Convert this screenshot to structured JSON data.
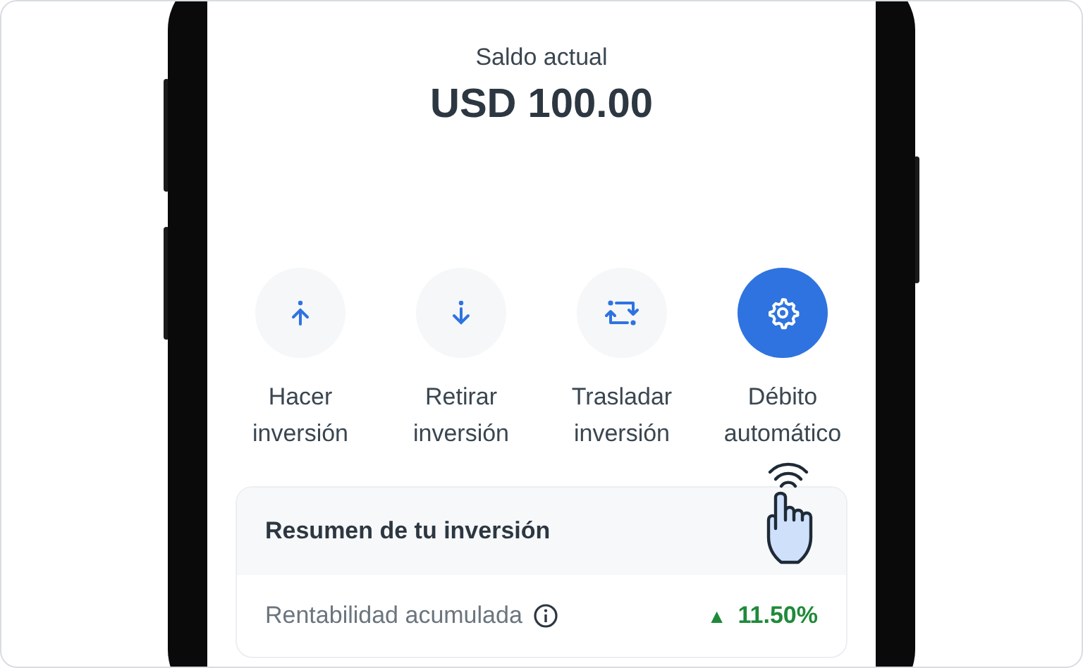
{
  "balance": {
    "label": "Saldo actual",
    "amount": "USD 100.00"
  },
  "actions": [
    {
      "kind": "invest",
      "label": "Hacer inversión",
      "selected": false
    },
    {
      "kind": "withdraw",
      "label": "Retirar inversión",
      "selected": false
    },
    {
      "kind": "transfer",
      "label": "Trasladar inversión",
      "selected": false
    },
    {
      "kind": "settings",
      "label": "Débito automático",
      "selected": true
    }
  ],
  "summary": {
    "title": "Resumen de tu inversión",
    "rows": [
      {
        "label": "Rentabilidad acumulada",
        "value": "11.50%",
        "trend_arrow": "▲"
      }
    ]
  }
}
